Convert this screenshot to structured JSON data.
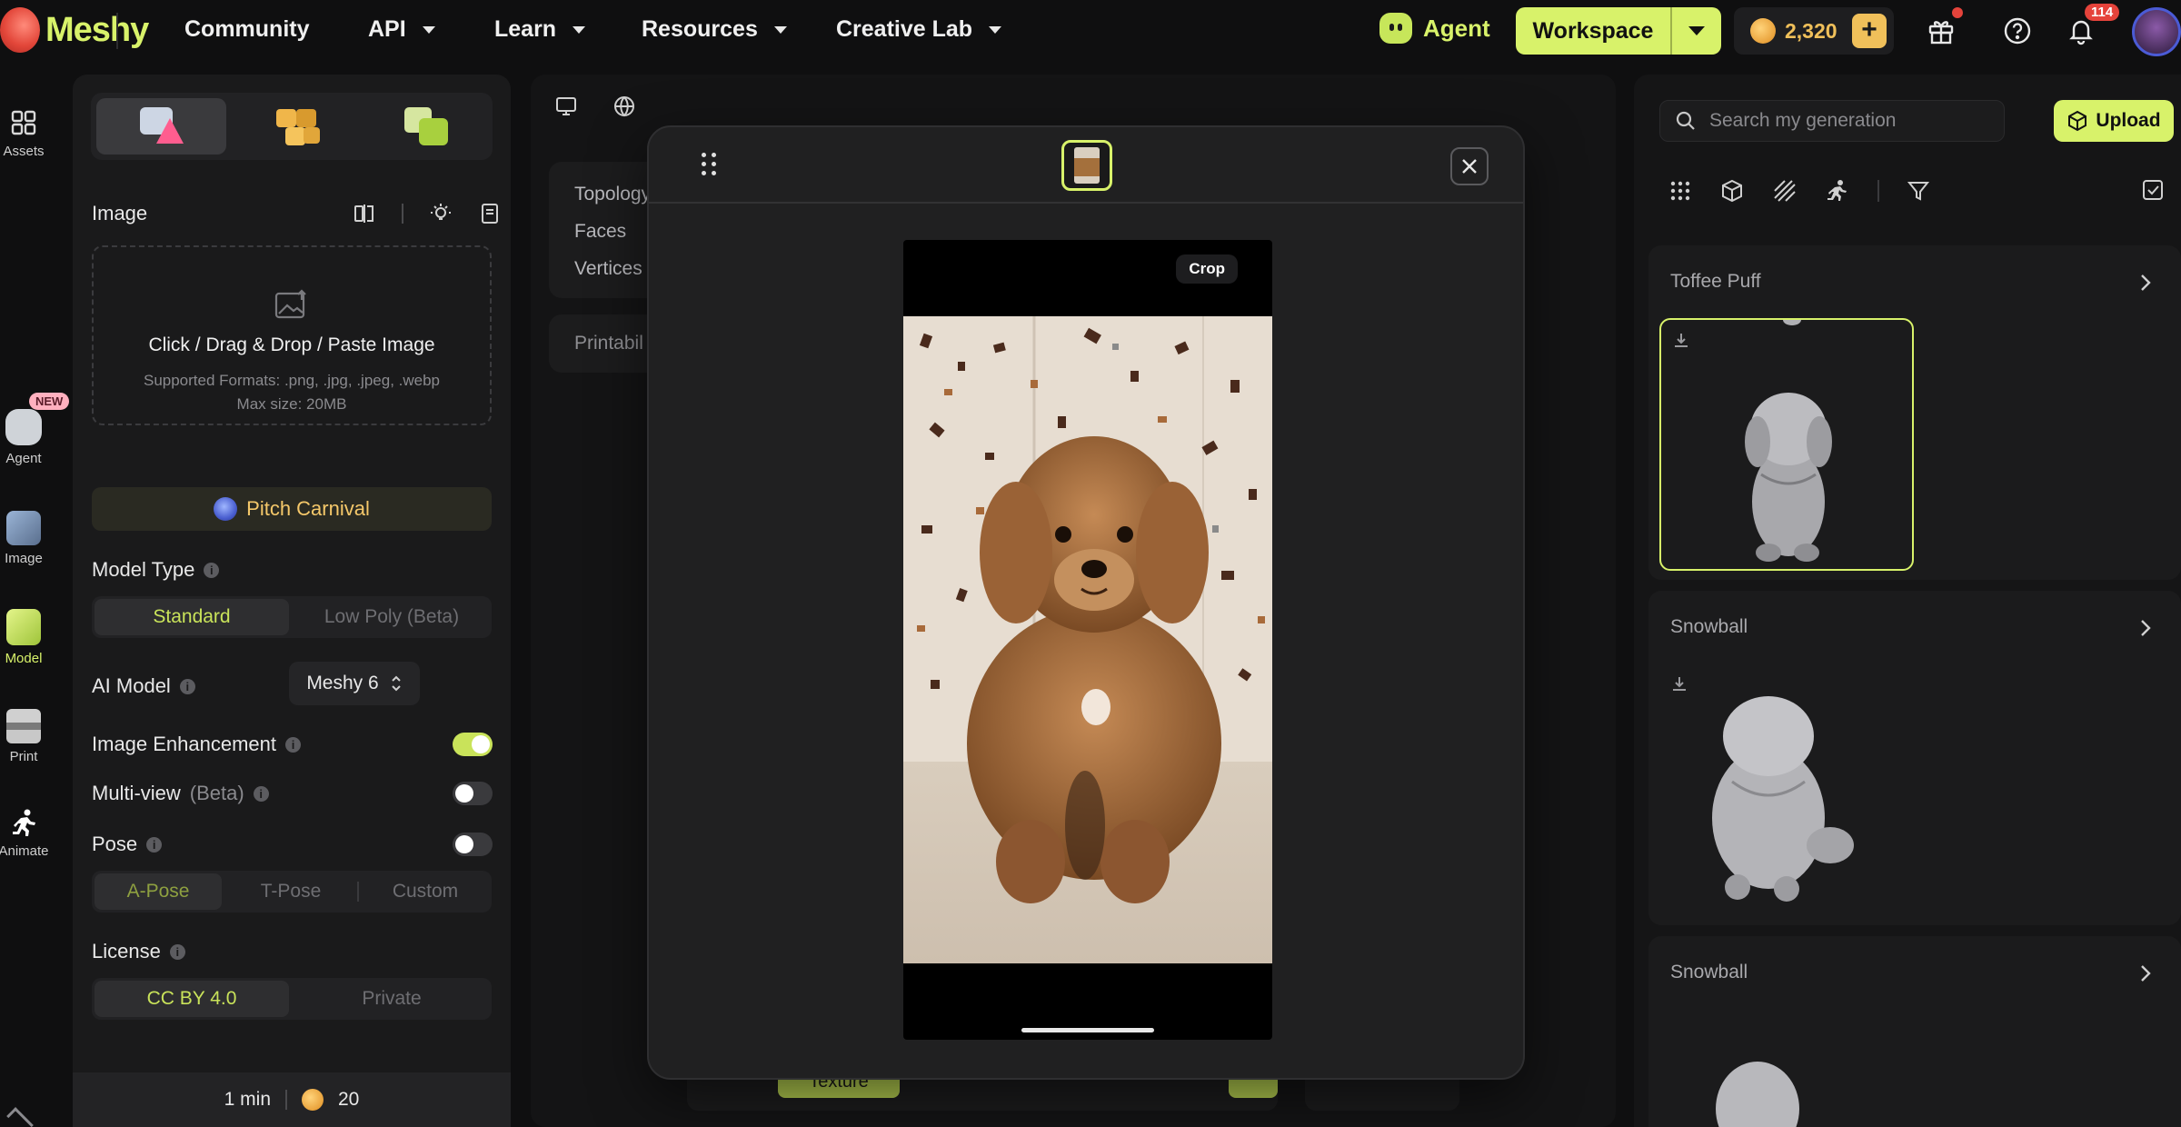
{
  "brand": {
    "logo_text": "Meshy"
  },
  "nav": {
    "community": "Community",
    "api": "API",
    "learn": "Learn",
    "resources": "Resources",
    "creative_lab": "Creative Lab",
    "agent": "Agent",
    "workspace": "Workspace",
    "credits": "2,320",
    "notifications_count": "114"
  },
  "rail": {
    "assets": "Assets",
    "agent": "Agent",
    "new_badge": "NEW",
    "image": "Image",
    "model": "Model",
    "print": "Print",
    "animate": "Animate"
  },
  "left_panel": {
    "image_label": "Image",
    "dropzone_title": "Click / Drag & Drop / Paste Image",
    "dropzone_formats": "Supported Formats: .png, .jpg, .jpeg, .webp",
    "dropzone_size": "Max size: 20MB",
    "pitch_carnival": "Pitch Carnival",
    "model_type_label": "Model Type",
    "model_type_options": [
      "Standard",
      "Low Poly (Beta)"
    ],
    "model_type_selected": "Standard",
    "ai_model_label": "AI Model",
    "ai_model_value": "Meshy 6",
    "image_enhancement_label": "Image Enhancement",
    "image_enhancement_on": true,
    "multiview_label": "Multi-view",
    "multiview_beta": "(Beta)",
    "multiview_on": false,
    "pose_label": "Pose",
    "pose_on": false,
    "pose_options": [
      "A-Pose",
      "T-Pose",
      "Custom"
    ],
    "pose_selected": "A-Pose",
    "license_label": "License",
    "license_options": [
      "CC BY 4.0",
      "Private"
    ],
    "license_selected": "CC BY 4.0",
    "footer_time": "1 min",
    "footer_cost": "20"
  },
  "center": {
    "stats": [
      "Topology",
      "Faces",
      "Vertices"
    ],
    "printability": "Printabil",
    "texture_button": "Texture"
  },
  "modal": {
    "crop_label": "Crop"
  },
  "right_panel": {
    "search_placeholder": "Search my generation",
    "upload": "Upload",
    "generations": [
      {
        "title": "Toffee Puff"
      },
      {
        "title": "Snowball"
      },
      {
        "title": "Snowball"
      }
    ]
  },
  "colors": {
    "accent": "#d8f26a",
    "coin": "#f0c05a",
    "badge_red": "#e5433b"
  }
}
